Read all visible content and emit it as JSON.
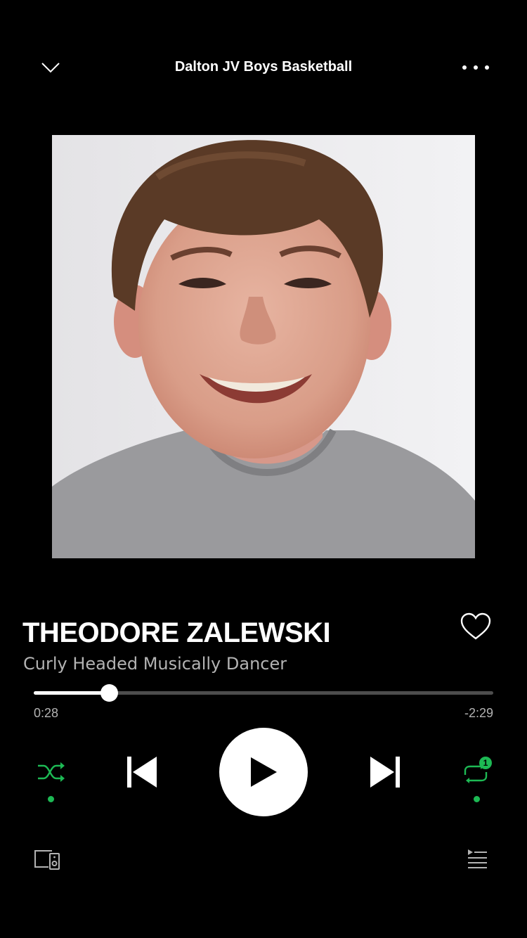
{
  "header": {
    "context_title": "Dalton JV Boys Basketball",
    "collapse_icon": "chevron-down-icon",
    "more_icon": "more-horizontal-icon"
  },
  "track": {
    "title": "THEODORE ZALEWSKI",
    "subtitle": "Curly Headed Musically Dancer",
    "liked": false
  },
  "playback": {
    "elapsed": "0:28",
    "remaining": "-2:29",
    "progress_fraction": 0.163,
    "is_playing": false
  },
  "controls": {
    "shuffle_on": true,
    "repeat_mode": "one",
    "repeat_badge": "1"
  },
  "colors": {
    "accent": "#1db954",
    "background": "#000000",
    "text_secondary": "#b3b3b3"
  }
}
